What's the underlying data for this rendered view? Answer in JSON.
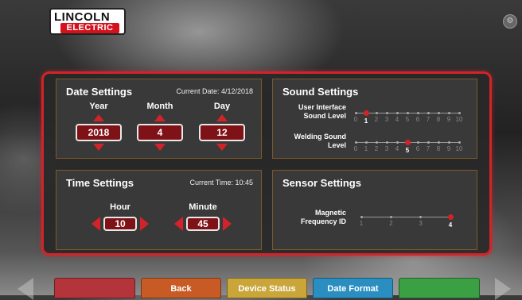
{
  "brand": {
    "line1": "LINCOLN",
    "line2": "ELECTRIC"
  },
  "date_settings": {
    "title": "Date Settings",
    "current": "Current Date: 4/12/2018",
    "fields": [
      {
        "label": "Year",
        "value": "2018"
      },
      {
        "label": "Month",
        "value": "4"
      },
      {
        "label": "Day",
        "value": "12"
      }
    ]
  },
  "sound_settings": {
    "title": "Sound Settings",
    "sliders": [
      {
        "label_line1": "User Interface",
        "label_line2": "Sound Level",
        "value": 1
      },
      {
        "label_line1": "Welding Sound",
        "label_line2": "Level",
        "value": 5
      }
    ],
    "scale": [
      "0",
      "1",
      "2",
      "3",
      "4",
      "5",
      "6",
      "7",
      "8",
      "9",
      "10"
    ]
  },
  "time_settings": {
    "title": "Time Settings",
    "current": "Current Time: 10:45",
    "fields": [
      {
        "label": "Hour",
        "value": "10"
      },
      {
        "label": "Minute",
        "value": "45"
      }
    ]
  },
  "sensor_settings": {
    "title": "Sensor Settings",
    "slider": {
      "label_line1": "Magnetic",
      "label_line2": "Frequency ID",
      "value": 4
    },
    "scale": [
      "1",
      "2",
      "3",
      "4"
    ]
  },
  "bottom_bar": {
    "buttons": [
      {
        "label": "",
        "color": "#b3343a"
      },
      {
        "label": "Back",
        "color": "#c85a26"
      },
      {
        "label": "Device Status",
        "color": "#c9a53a"
      },
      {
        "label": "Date Format",
        "color": "#2a8fc0"
      },
      {
        "label": "",
        "color": "#3aa043"
      }
    ]
  },
  "colors": {
    "accent": "#d2232a",
    "panel_border": "#7a5a2a",
    "value_box": "#7e1217"
  }
}
